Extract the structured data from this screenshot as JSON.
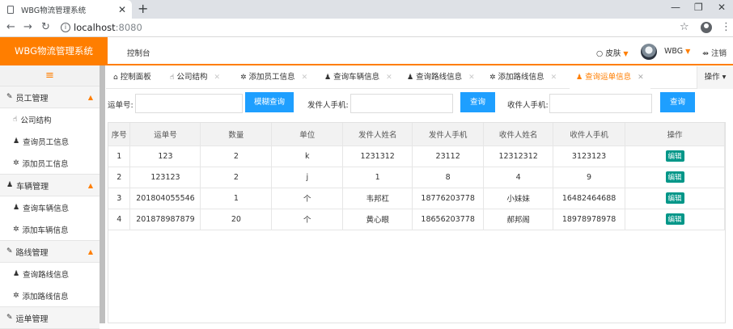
{
  "browser": {
    "tab_title": "WBG物流管理系统",
    "url_host": "localhost",
    "url_port": ":8080"
  },
  "header": {
    "logo": "WBG物流管理系统",
    "console": "控制台",
    "skin": "皮肤",
    "user": "WBG",
    "logout": "注销"
  },
  "sidebar": {
    "toggle": "≡",
    "groups": [
      {
        "label": "员工管理",
        "items": [
          "公司结构",
          "查询员工信息",
          "添加员工信息"
        ]
      },
      {
        "label": "车辆管理",
        "items": [
          "查询车辆信息",
          "添加车辆信息"
        ]
      },
      {
        "label": "路线管理",
        "items": [
          "查询路线信息",
          "添加路线信息"
        ]
      },
      {
        "label": "运单管理"
      }
    ]
  },
  "tabs": [
    {
      "label": "控制面板"
    },
    {
      "label": "公司结构"
    },
    {
      "label": "添加员工信息"
    },
    {
      "label": "查询车辆信息"
    },
    {
      "label": "查询路线信息"
    },
    {
      "label": "添加路线信息"
    },
    {
      "label": "查询运单信息"
    }
  ],
  "operations": "操作",
  "search": {
    "waybill_label": "运单号:",
    "fuzzy_button": "模糊查询",
    "sender_phone_label": "发件人手机:",
    "query_button": "查询",
    "receiver_phone_label": "收件人手机:",
    "query_button2": "查询"
  },
  "table": {
    "headers": [
      "序号",
      "运单号",
      "数量",
      "单位",
      "发件人姓名",
      "发件人手机",
      "收件人姓名",
      "收件人手机",
      "操作"
    ],
    "rows": [
      [
        "1",
        "123",
        "2",
        "k",
        "1231312",
        "23112",
        "12312312",
        "3123123",
        "编辑"
      ],
      [
        "2",
        "123123",
        "2",
        "j",
        "1",
        "8",
        "4",
        "9",
        "编辑"
      ],
      [
        "3",
        "201804055546",
        "1",
        "个",
        "韦邦杠",
        "18776203778",
        "小妹妹",
        "16482464688",
        "编辑"
      ],
      [
        "4",
        "201878987879",
        "20",
        "个",
        "黄心眼",
        "18656203778",
        "郝邦阁",
        "18978978978",
        "编辑"
      ]
    ]
  },
  "colors": {
    "brand": "#ff7e00",
    "button": "#1e9fff",
    "edit": "#009688"
  }
}
